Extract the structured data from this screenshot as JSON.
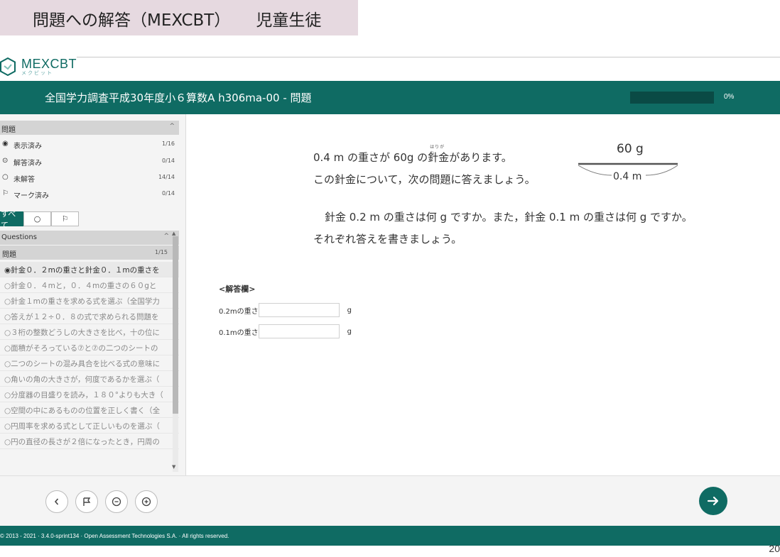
{
  "slide": {
    "title_left": "問題への解答（MEXCBT）",
    "title_right": "児童生徒",
    "page_number": "20"
  },
  "brand": {
    "name": "MEXCBT",
    "subtitle": "メクビット"
  },
  "header": {
    "title": "全国学力調査平成30年度小６算数A h306ma-00 - 問題",
    "progress_percent": "0%",
    "progress_value": 0
  },
  "sidebar": {
    "section_title": "問題",
    "stats": [
      {
        "icon": "◉",
        "label": "表示済み",
        "count": "1/16"
      },
      {
        "icon": "⊙",
        "label": "解答済み",
        "count": "0/14"
      },
      {
        "icon": "○",
        "label": "未解答",
        "count": "14/14"
      },
      {
        "icon": "⚐",
        "label": "マーク済み",
        "count": "0/14"
      }
    ],
    "filters": {
      "all": "すべて",
      "unanswered": "○",
      "flagged": "⚐"
    },
    "questions_title": "Questions",
    "part_title": "問題",
    "part_count": "1/15",
    "items": [
      "◉針金０．２mの重さと針金０．１mの重さを",
      "○針金０．４mと，０．４mの重さの６０gと",
      "○針金１mの重さを求める式を選ぶ（全国学力",
      "○答えが１２÷０．８の式で求められる問題を",
      "○３桁の整数どうしの大きさを比べ，十の位に",
      "○面積がそろっている⑦と⑦の二つのシートの",
      "○二つのシートの混み具合を比べる式の意味に",
      "○角いの角の大きさが，何度であるかを選ぶ（",
      "○分度器の目盛りを読み，１８０°よりも大き（",
      "○空間の中にあるものの位置を正しく書く（全",
      "○円周率を求める式として正しいものを選ぶ（",
      "○円の直径の長さが２倍になったとき，円周の"
    ]
  },
  "question": {
    "line1_a": "0.4 m の重さが 60",
    "line1_unit": "g",
    "line1_b": " の",
    "line1_word": "針金",
    "line1_ruby": "はりがね",
    "line1_c": "があります。",
    "line2": "この針金について，次の問題に答えましょう。",
    "line3": "針金 0.2 m の重さは何 g ですか。また，針金 0.1 m の重さは何 g ですか。",
    "line4": "それぞれ答えを書きましょう。",
    "figure_weight": "60 g",
    "figure_length": "0.4 m"
  },
  "answer": {
    "header": "<解答欄>",
    "rows": [
      {
        "label": "0.2mの重さ",
        "value": "",
        "unit": "g"
      },
      {
        "label": "0.1mの重さ",
        "value": "",
        "unit": "g"
      }
    ]
  },
  "footer": {
    "copyright": "© 2013 - 2021 · 3.4.0-sprint134 · Open Assessment Technologies S.A. · All rights reserved."
  }
}
